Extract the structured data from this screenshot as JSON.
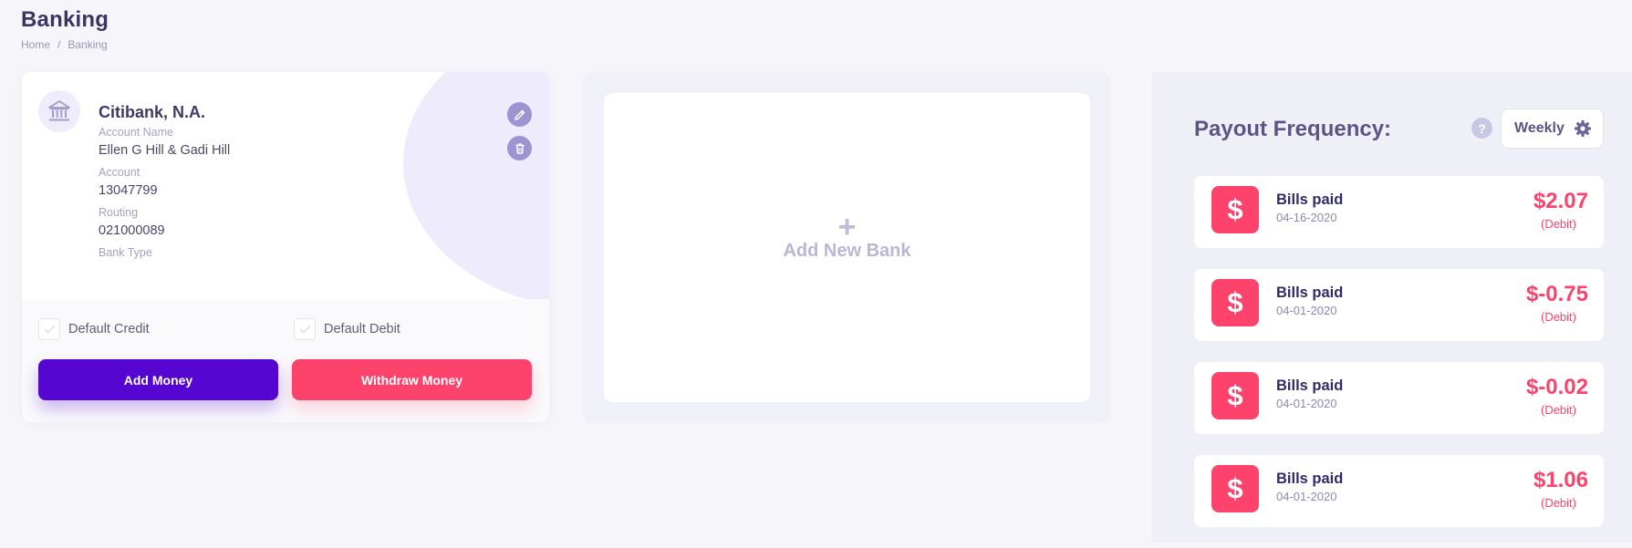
{
  "page": {
    "title": "Banking",
    "breadcrumb": [
      "Home",
      "Banking"
    ],
    "breadcrumb_separator": "/"
  },
  "bank_card": {
    "bank_name": "Citibank, N.A.",
    "fields": [
      {
        "label": "Account Name",
        "value": "Ellen G Hill & Gadi Hill"
      },
      {
        "label": "Account",
        "value": "13047799"
      },
      {
        "label": "Routing",
        "value": "021000089"
      },
      {
        "label": "Bank Type",
        "value": ""
      }
    ],
    "icons": {
      "avatar": "bank-icon",
      "edit": "pencil-icon",
      "delete": "trash-icon"
    },
    "default_credit_label": "Default Credit",
    "default_debit_label": "Default Debit",
    "add_money_label": "Add Money",
    "withdraw_money_label": "Withdraw Money"
  },
  "add_bank": {
    "plus": "+",
    "label": "Add New Bank"
  },
  "payout": {
    "title": "Payout Frequency:",
    "help": "?",
    "frequency": "Weekly",
    "settings_icon": "gear-icon",
    "transactions": [
      {
        "icon": "$",
        "title": "Bills paid",
        "date": "04-16-2020",
        "amount": "$2.07",
        "type": "(Debit)"
      },
      {
        "icon": "$",
        "title": "Bills paid",
        "date": "04-01-2020",
        "amount": "$-0.75",
        "type": "(Debit)"
      },
      {
        "icon": "$",
        "title": "Bills paid",
        "date": "04-01-2020",
        "amount": "$-0.02",
        "type": "(Debit)"
      },
      {
        "icon": "$",
        "title": "Bills paid",
        "date": "04-01-2020",
        "amount": "$1.06",
        "type": "(Debit)"
      }
    ]
  },
  "colors": {
    "primary_purple": "#5606d1",
    "accent_pink": "#fd436c",
    "title_text": "#3b3561",
    "muted_text": "#a4a2bc"
  }
}
